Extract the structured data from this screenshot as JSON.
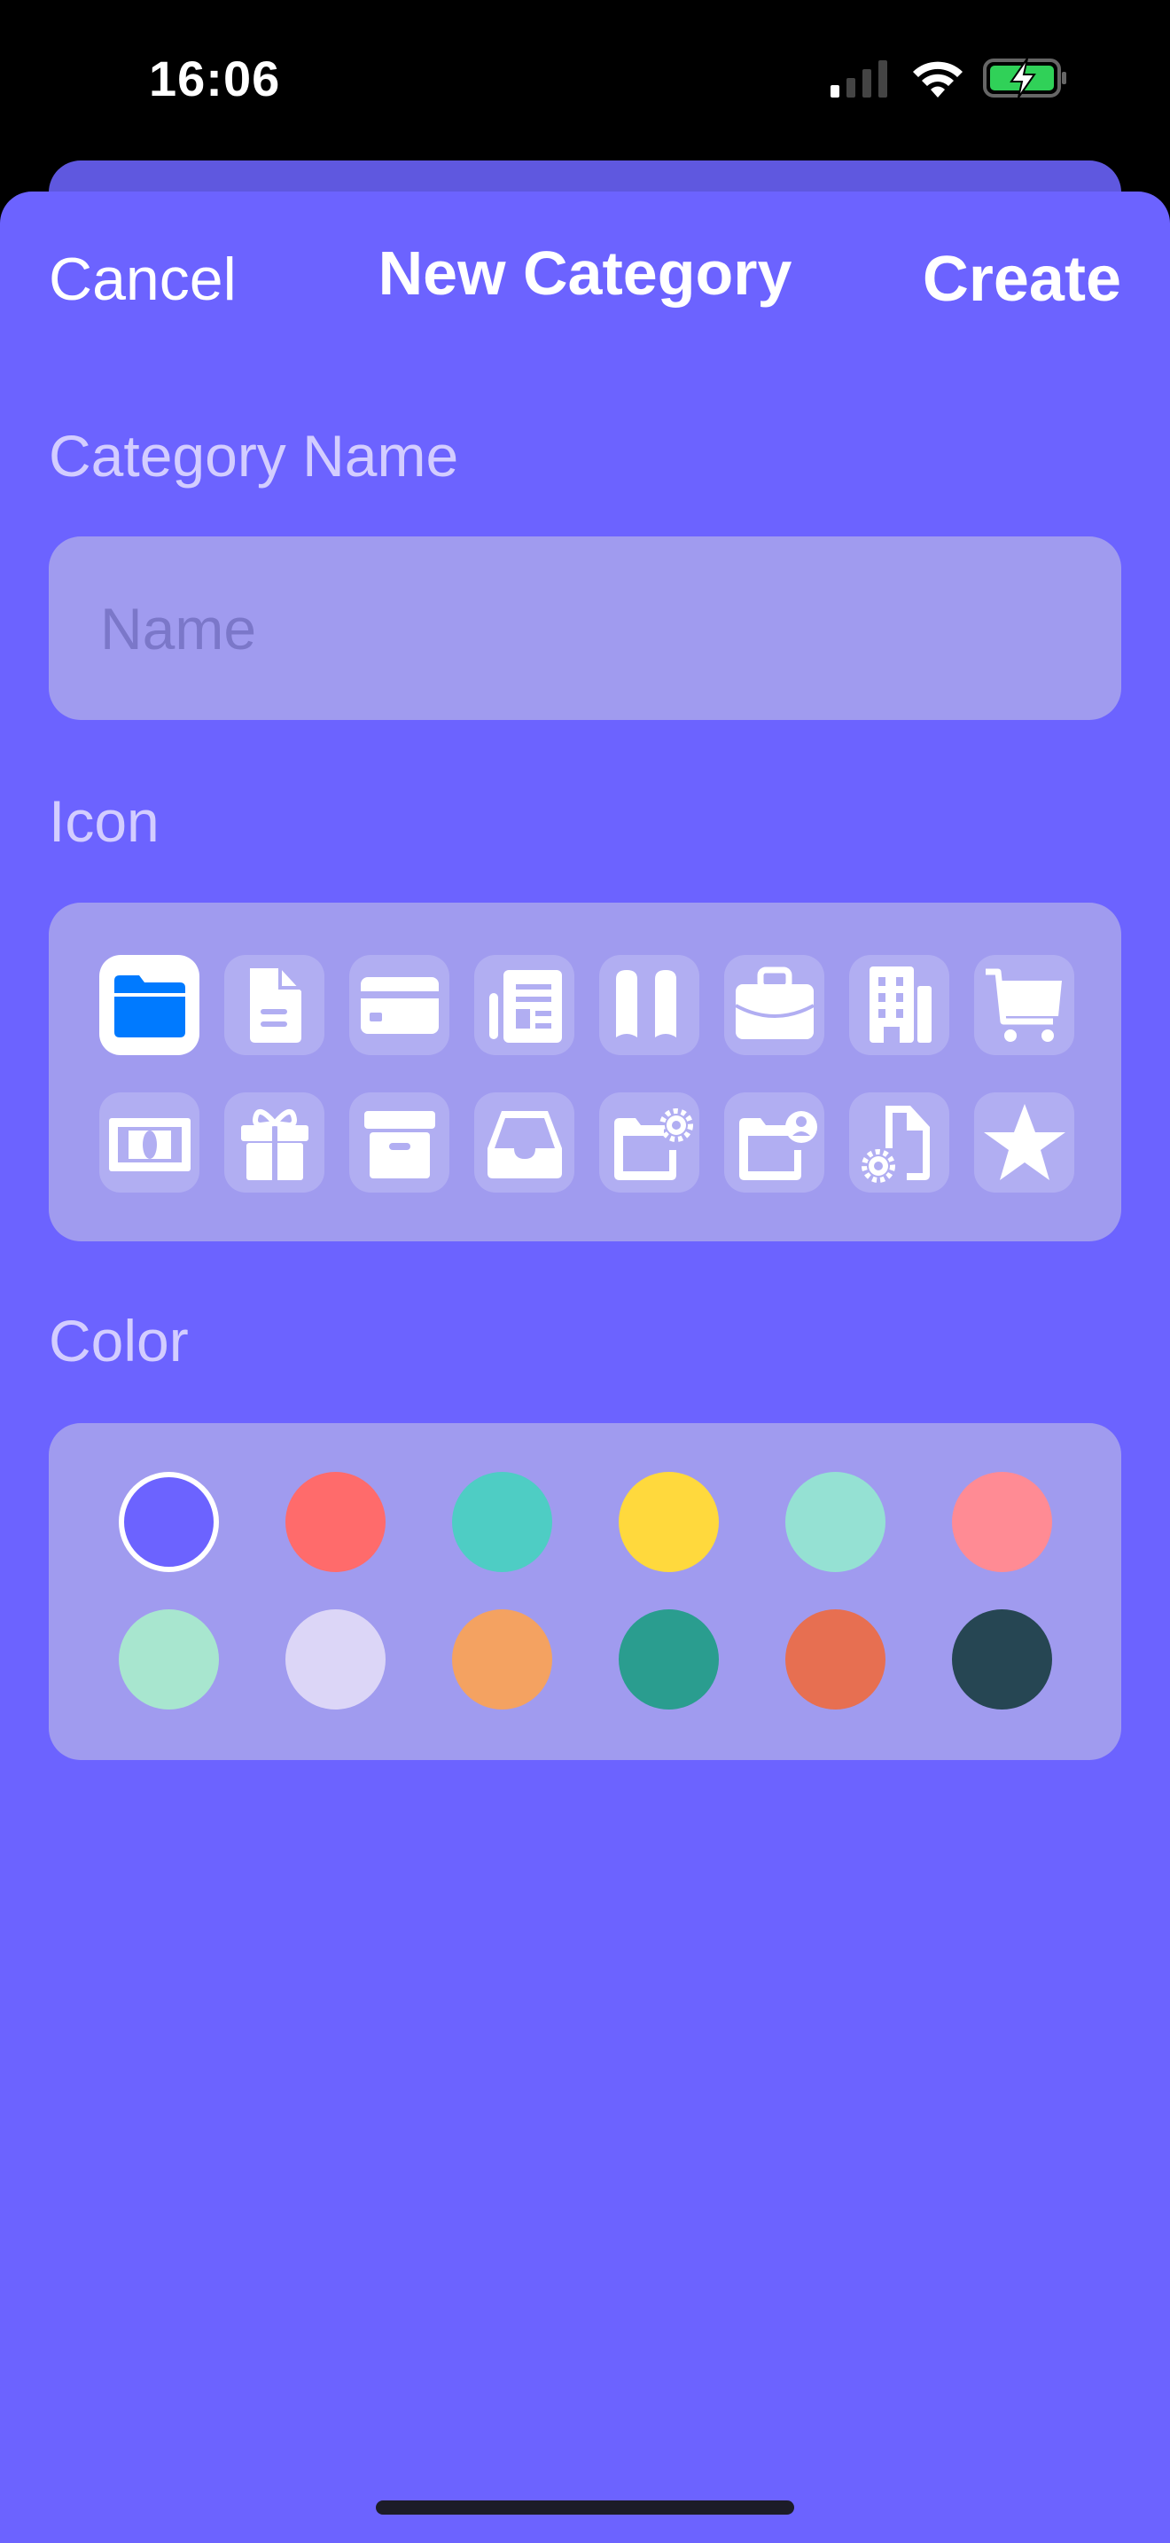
{
  "status_bar": {
    "time": "16:06",
    "signal": "signal-icon",
    "wifi": "wifi-icon",
    "battery": "battery-charging-icon"
  },
  "nav": {
    "cancel": "Cancel",
    "title": "New Category",
    "create": "Create"
  },
  "name_section": {
    "label": "Category Name",
    "placeholder": "Name",
    "value": ""
  },
  "icon_section": {
    "label": "Icon",
    "selected": 0,
    "icons": [
      "folder",
      "doc",
      "creditcard",
      "newspaper",
      "book",
      "briefcase",
      "building",
      "cart",
      "banknote",
      "gift",
      "archivebox",
      "tray",
      "folder-badge-gear",
      "folder-badge-person",
      "doc-badge-gear",
      "star"
    ]
  },
  "color_section": {
    "label": "Color",
    "selected": 0,
    "colors": [
      "#6c63ff",
      "#ff6b6b",
      "#4ecdc4",
      "#ffd93d",
      "#95e1d3",
      "#ff8b94",
      "#a8e6cf",
      "#dcd6f7",
      "#f4a261",
      "#2a9d8f",
      "#e76f51",
      "#264653"
    ]
  },
  "theme": {
    "background": "#6c63ff",
    "panel": "#a09bef",
    "selected_icon": "#007aff"
  }
}
